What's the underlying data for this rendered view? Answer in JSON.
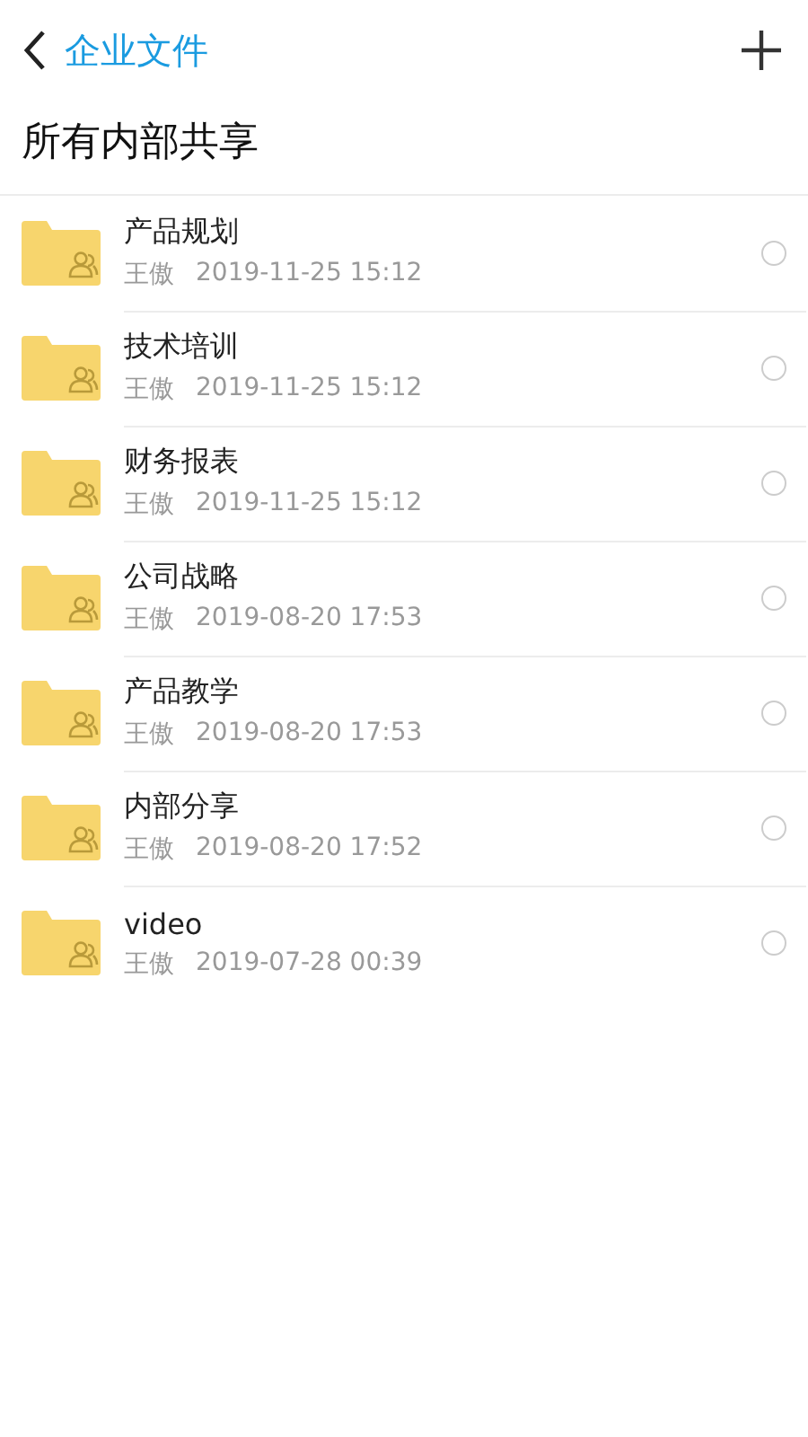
{
  "header": {
    "title": "企业文件"
  },
  "heading": "所有内部共享",
  "files": [
    {
      "name": "产品规划",
      "owner": "王傲",
      "time": "2019-11-25 15:12",
      "selected": false
    },
    {
      "name": "技术培训",
      "owner": "王傲",
      "time": "2019-11-25 15:12",
      "selected": false
    },
    {
      "name": "财务报表",
      "owner": "王傲",
      "time": "2019-11-25 15:12",
      "selected": false
    },
    {
      "name": "公司战略",
      "owner": "王傲",
      "time": "2019-08-20 17:53",
      "selected": false
    },
    {
      "name": "产品教学",
      "owner": "王傲",
      "time": "2019-08-20 17:53",
      "selected": false
    },
    {
      "name": "内部分享",
      "owner": "王傲",
      "time": "2019-08-20 17:52",
      "selected": false
    },
    {
      "name": "video",
      "owner": "王傲",
      "time": "2019-07-28 00:39",
      "selected": false
    }
  ]
}
